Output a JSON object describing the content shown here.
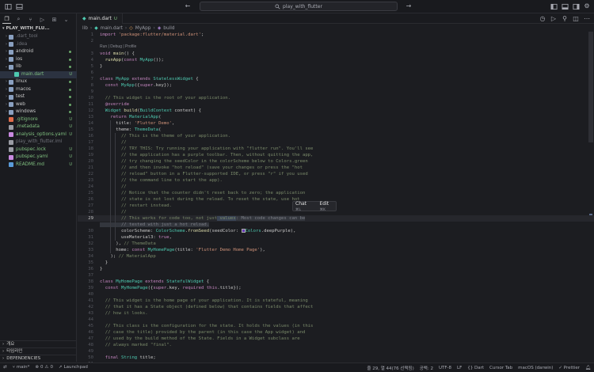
{
  "titlebar": {
    "search_text": "play_with_flutter"
  },
  "sidebar": {
    "title": "PLAY_WITH_FLU...",
    "items": [
      {
        "label": ".dart_tool",
        "kind": "folder",
        "badge": "",
        "dim": true
      },
      {
        "label": ".idea",
        "kind": "folder",
        "badge": "",
        "dim": true
      },
      {
        "label": "android",
        "kind": "folder",
        "badge": "•",
        "dim": false
      },
      {
        "label": "ios",
        "kind": "folder",
        "badge": "•",
        "dim": false
      },
      {
        "label": "lib",
        "kind": "folder",
        "badge": "•",
        "dim": false,
        "open": true
      },
      {
        "label": "main.dart",
        "kind": "dart",
        "badge": "U",
        "dim": false,
        "child": true,
        "selected": true
      },
      {
        "label": "linux",
        "kind": "folder",
        "badge": "•",
        "dim": false
      },
      {
        "label": "macos",
        "kind": "folder",
        "badge": "•",
        "dim": false
      },
      {
        "label": "test",
        "kind": "folder",
        "badge": "•",
        "dim": false
      },
      {
        "label": "web",
        "kind": "folder",
        "badge": "•",
        "dim": false
      },
      {
        "label": "windows",
        "kind": "folder",
        "badge": "•",
        "dim": false
      },
      {
        "label": ".gitignore",
        "kind": "git",
        "badge": "U",
        "dim": false
      },
      {
        "label": ".metadata",
        "kind": "file",
        "badge": "U",
        "dim": false
      },
      {
        "label": "analysis_options.yaml",
        "kind": "yaml",
        "badge": "U",
        "dim": false
      },
      {
        "label": "play_with_flutter.iml",
        "kind": "file",
        "badge": "",
        "dim": true
      },
      {
        "label": "pubspec.lock",
        "kind": "file",
        "badge": "U",
        "dim": false
      },
      {
        "label": "pubspec.yaml",
        "kind": "yaml",
        "badge": "U",
        "dim": false
      },
      {
        "label": "README.md",
        "kind": "md",
        "badge": "U",
        "dim": false
      }
    ],
    "outline_label": "개요",
    "timeline_label": "타임라인",
    "dependencies_label": "DEPENDENCIES"
  },
  "editor": {
    "tab_label": "main.dart",
    "tab_badge": "U",
    "breadcrumb": [
      "lib",
      "main.dart",
      "MyApp",
      "build"
    ],
    "codelens": "Run | Debug | Profile",
    "popup": {
      "chat": "Chat",
      "chat_kbd": "⌘L",
      "edit": "Edit",
      "edit_kbd": "⌘K"
    }
  },
  "statusbar": {
    "branch": "main*",
    "errors": "0",
    "warnings": "0",
    "launchpad": "Launchpad",
    "position": "줄 29, 열 44(76 선택됨)",
    "spaces": "공백: 2",
    "encoding": "UTF-8",
    "eol": "LF",
    "language": "{} Dart",
    "cursor_tab": "Cursor Tab",
    "device": "macOS (darwin)",
    "prettier": "✓ Prettier"
  },
  "colors": {
    "accent": "#4ec9b0",
    "keyword": "#c586c0",
    "string": "#ce9178",
    "comment": "#7a8a6a",
    "untracked": "#7fbf7f"
  }
}
